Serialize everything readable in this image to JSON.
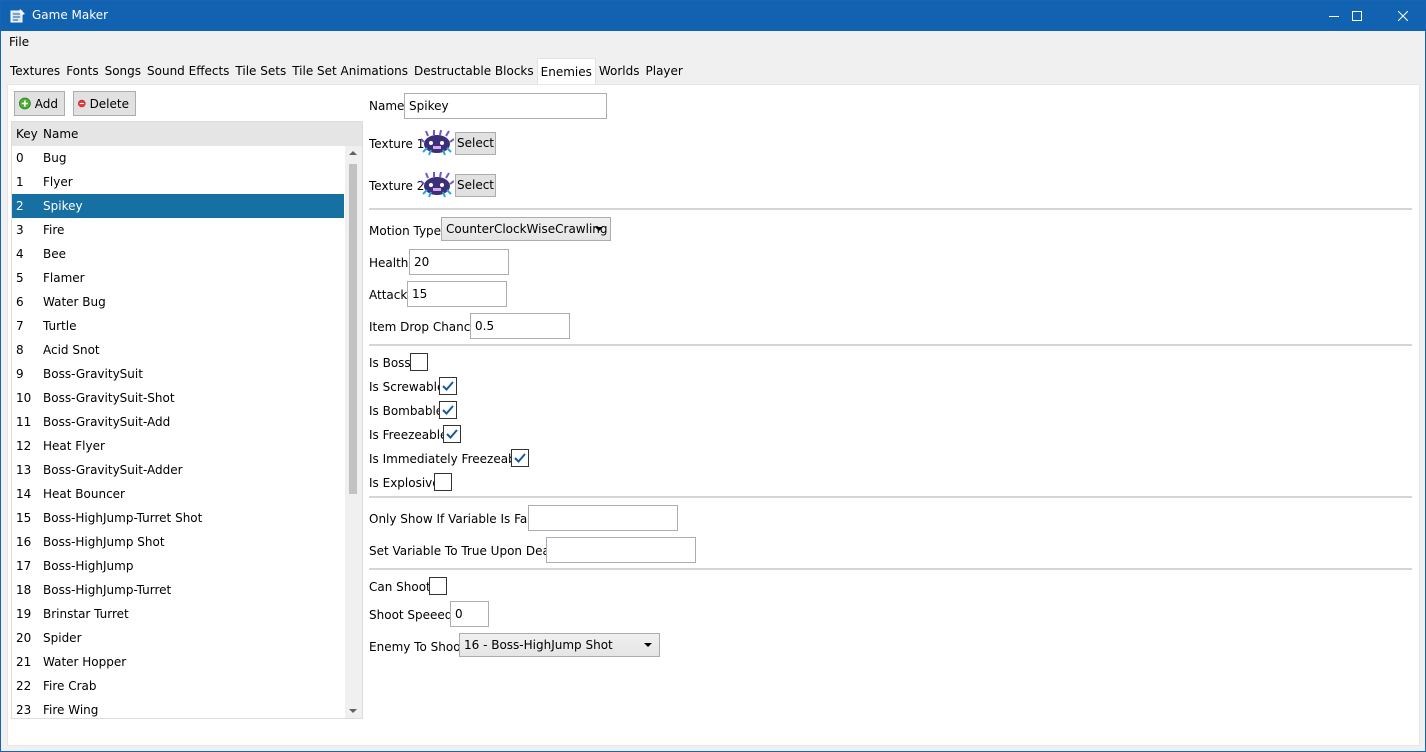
{
  "window": {
    "title": "Game Maker"
  },
  "menu": {
    "file": "File"
  },
  "tabs": [
    "Textures",
    "Fonts",
    "Songs",
    "Sound Effects",
    "Tile Sets",
    "Tile Set Animations",
    "Destructable Blocks",
    "Enemies",
    "Worlds",
    "Player"
  ],
  "active_tab": "Enemies",
  "toolbar": {
    "add_label": "Add",
    "delete_label": "Delete"
  },
  "list": {
    "headers": {
      "key": "Key",
      "name": "Name"
    },
    "selected_key": "2",
    "rows": [
      {
        "key": "0",
        "name": "Bug"
      },
      {
        "key": "1",
        "name": "Flyer"
      },
      {
        "key": "2",
        "name": "Spikey"
      },
      {
        "key": "3",
        "name": "Fire"
      },
      {
        "key": "4",
        "name": "Bee"
      },
      {
        "key": "5",
        "name": "Flamer"
      },
      {
        "key": "6",
        "name": "Water Bug"
      },
      {
        "key": "7",
        "name": "Turtle"
      },
      {
        "key": "8",
        "name": "Acid Snot"
      },
      {
        "key": "9",
        "name": "Boss-GravitySuit"
      },
      {
        "key": "10",
        "name": "Boss-GravitySuit-Shot"
      },
      {
        "key": "11",
        "name": "Boss-GravitySuit-Add"
      },
      {
        "key": "12",
        "name": "Heat Flyer"
      },
      {
        "key": "13",
        "name": "Boss-GravitySuit-Adder"
      },
      {
        "key": "14",
        "name": "Heat Bouncer"
      },
      {
        "key": "15",
        "name": "Boss-HighJump-Turret Shot"
      },
      {
        "key": "16",
        "name": "Boss-HighJump Shot"
      },
      {
        "key": "17",
        "name": "Boss-HighJump"
      },
      {
        "key": "18",
        "name": "Boss-HighJump-Turret"
      },
      {
        "key": "19",
        "name": "Brinstar Turret"
      },
      {
        "key": "20",
        "name": "Spider"
      },
      {
        "key": "21",
        "name": "Water Hopper"
      },
      {
        "key": "22",
        "name": "Fire Crab"
      },
      {
        "key": "23",
        "name": "Fire Wing"
      }
    ]
  },
  "form": {
    "name_label": "Name:",
    "name_value": "Spikey",
    "texture1_label": "Texture 1:",
    "texture2_label": "Texture 2:",
    "select_label": "Select",
    "motion_type_label": "Motion Type:",
    "motion_type_value": "CounterClockWiseCrawling",
    "health_label": "Health:",
    "health_value": "20",
    "attack_label": "Attack:",
    "attack_value": "15",
    "item_drop_label": "Item Drop Chance:",
    "item_drop_value": "0.5",
    "is_boss_label": "Is Boss:",
    "is_boss": false,
    "is_screwable_label": "Is Screwable:",
    "is_screwable": true,
    "is_bombable_label": "Is Bombable:",
    "is_bombable": true,
    "is_freezeable_label": "Is Freezeable:",
    "is_freezeable": true,
    "is_immediately_freezeable_label": "Is Immediately Freezeable:",
    "is_immediately_freezeable": true,
    "is_explosive_label": "Is Explosive:",
    "is_explosive": false,
    "only_show_label": "Only Show If Variable Is False:",
    "only_show_value": "",
    "set_variable_label": "Set Variable To True Upon Death:",
    "set_variable_value": "",
    "can_shoot_label": "Can Shoot:",
    "can_shoot": false,
    "shoot_speed_label": "Shoot Speeed:",
    "shoot_speed_value": "0",
    "enemy_to_shoot_label": "Enemy To Shoot:",
    "enemy_to_shoot_value": "16 - Boss-HighJump Shot"
  },
  "colors": {
    "titlebar": "#1162b0",
    "selection": "#1670a2",
    "check": "#1a5a96"
  }
}
